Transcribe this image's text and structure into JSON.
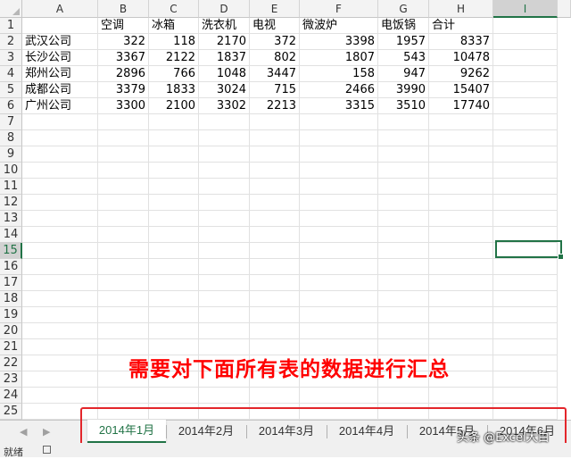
{
  "columns": [
    "A",
    "B",
    "C",
    "D",
    "E",
    "F",
    "G",
    "H",
    "I"
  ],
  "selected_column": "I",
  "row_numbers": [
    "1",
    "2",
    "3",
    "4",
    "5",
    "6",
    "7",
    "8",
    "9",
    "10",
    "11",
    "12",
    "13",
    "14",
    "15",
    "16",
    "17",
    "18",
    "19",
    "20",
    "21",
    "22",
    "23",
    "24",
    "25"
  ],
  "selected_row": "15",
  "headers": [
    "",
    "空调",
    "冰箱",
    "洗衣机",
    "电视",
    "微波炉",
    "电饭锅",
    "合计"
  ],
  "rows": [
    [
      "武汉公司",
      "322",
      "118",
      "2170",
      "372",
      "3398",
      "1957",
      "8337"
    ],
    [
      "长沙公司",
      "3367",
      "2122",
      "1837",
      "802",
      "1807",
      "543",
      "10478"
    ],
    [
      "郑州公司",
      "2896",
      "766",
      "1048",
      "3447",
      "158",
      "947",
      "9262"
    ],
    [
      "成都公司",
      "3379",
      "1833",
      "3024",
      "715",
      "2466",
      "3990",
      "15407"
    ],
    [
      "广州公司",
      "3300",
      "2100",
      "3302",
      "2213",
      "3315",
      "3510",
      "17740"
    ]
  ],
  "annotation": "需要对下面所有表的数据进行汇总",
  "sheet_tabs": [
    "2014年1月",
    "2014年2月",
    "2014年3月",
    "2014年4月",
    "2014年5月",
    "2014年6月"
  ],
  "active_tab": "2014年1月",
  "status": {
    "ready": "就绪"
  },
  "watermark": "头条 @Excel大白",
  "colors": {
    "accent": "#217346",
    "annotation": "#ff0000",
    "highlight_box": "#e3262b"
  }
}
